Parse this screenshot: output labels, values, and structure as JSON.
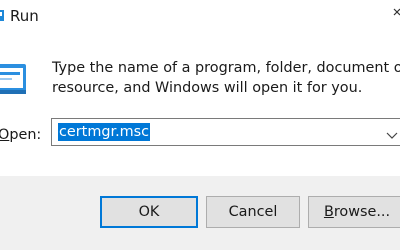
{
  "window": {
    "title": "Run",
    "close_icon": "close-icon"
  },
  "message": {
    "line1": "Type the name of a program, folder, document or Internet",
    "line2": "resource, and Windows will open it for you."
  },
  "open": {
    "label_accel": "O",
    "label_rest": "pen:",
    "value": "certmgr.msc",
    "dropdown_icon": "chevron-down-icon"
  },
  "buttons": {
    "ok": "OK",
    "cancel": "Cancel",
    "browse_accel": "B",
    "browse_rest": "rowse..."
  },
  "colors": {
    "selection": "#0078d7",
    "footer": "#f0f0f0",
    "button": "#e1e1e1"
  }
}
